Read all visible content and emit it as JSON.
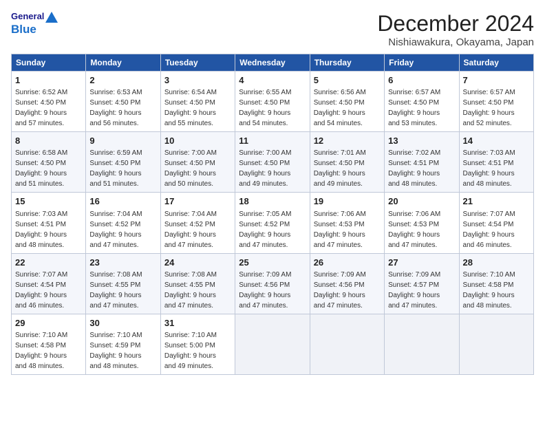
{
  "header": {
    "logo_line1": "General",
    "logo_line2": "Blue",
    "month": "December 2024",
    "location": "Nishiawakura, Okayama, Japan"
  },
  "columns": [
    "Sunday",
    "Monday",
    "Tuesday",
    "Wednesday",
    "Thursday",
    "Friday",
    "Saturday"
  ],
  "weeks": [
    [
      {
        "day": "1",
        "info": "Sunrise: 6:52 AM\nSunset: 4:50 PM\nDaylight: 9 hours\nand 57 minutes."
      },
      {
        "day": "2",
        "info": "Sunrise: 6:53 AM\nSunset: 4:50 PM\nDaylight: 9 hours\nand 56 minutes."
      },
      {
        "day": "3",
        "info": "Sunrise: 6:54 AM\nSunset: 4:50 PM\nDaylight: 9 hours\nand 55 minutes."
      },
      {
        "day": "4",
        "info": "Sunrise: 6:55 AM\nSunset: 4:50 PM\nDaylight: 9 hours\nand 54 minutes."
      },
      {
        "day": "5",
        "info": "Sunrise: 6:56 AM\nSunset: 4:50 PM\nDaylight: 9 hours\nand 54 minutes."
      },
      {
        "day": "6",
        "info": "Sunrise: 6:57 AM\nSunset: 4:50 PM\nDaylight: 9 hours\nand 53 minutes."
      },
      {
        "day": "7",
        "info": "Sunrise: 6:57 AM\nSunset: 4:50 PM\nDaylight: 9 hours\nand 52 minutes."
      }
    ],
    [
      {
        "day": "8",
        "info": "Sunrise: 6:58 AM\nSunset: 4:50 PM\nDaylight: 9 hours\nand 51 minutes."
      },
      {
        "day": "9",
        "info": "Sunrise: 6:59 AM\nSunset: 4:50 PM\nDaylight: 9 hours\nand 51 minutes."
      },
      {
        "day": "10",
        "info": "Sunrise: 7:00 AM\nSunset: 4:50 PM\nDaylight: 9 hours\nand 50 minutes."
      },
      {
        "day": "11",
        "info": "Sunrise: 7:00 AM\nSunset: 4:50 PM\nDaylight: 9 hours\nand 49 minutes."
      },
      {
        "day": "12",
        "info": "Sunrise: 7:01 AM\nSunset: 4:50 PM\nDaylight: 9 hours\nand 49 minutes."
      },
      {
        "day": "13",
        "info": "Sunrise: 7:02 AM\nSunset: 4:51 PM\nDaylight: 9 hours\nand 48 minutes."
      },
      {
        "day": "14",
        "info": "Sunrise: 7:03 AM\nSunset: 4:51 PM\nDaylight: 9 hours\nand 48 minutes."
      }
    ],
    [
      {
        "day": "15",
        "info": "Sunrise: 7:03 AM\nSunset: 4:51 PM\nDaylight: 9 hours\nand 48 minutes."
      },
      {
        "day": "16",
        "info": "Sunrise: 7:04 AM\nSunset: 4:52 PM\nDaylight: 9 hours\nand 47 minutes."
      },
      {
        "day": "17",
        "info": "Sunrise: 7:04 AM\nSunset: 4:52 PM\nDaylight: 9 hours\nand 47 minutes."
      },
      {
        "day": "18",
        "info": "Sunrise: 7:05 AM\nSunset: 4:52 PM\nDaylight: 9 hours\nand 47 minutes."
      },
      {
        "day": "19",
        "info": "Sunrise: 7:06 AM\nSunset: 4:53 PM\nDaylight: 9 hours\nand 47 minutes."
      },
      {
        "day": "20",
        "info": "Sunrise: 7:06 AM\nSunset: 4:53 PM\nDaylight: 9 hours\nand 47 minutes."
      },
      {
        "day": "21",
        "info": "Sunrise: 7:07 AM\nSunset: 4:54 PM\nDaylight: 9 hours\nand 46 minutes."
      }
    ],
    [
      {
        "day": "22",
        "info": "Sunrise: 7:07 AM\nSunset: 4:54 PM\nDaylight: 9 hours\nand 46 minutes."
      },
      {
        "day": "23",
        "info": "Sunrise: 7:08 AM\nSunset: 4:55 PM\nDaylight: 9 hours\nand 47 minutes."
      },
      {
        "day": "24",
        "info": "Sunrise: 7:08 AM\nSunset: 4:55 PM\nDaylight: 9 hours\nand 47 minutes."
      },
      {
        "day": "25",
        "info": "Sunrise: 7:09 AM\nSunset: 4:56 PM\nDaylight: 9 hours\nand 47 minutes."
      },
      {
        "day": "26",
        "info": "Sunrise: 7:09 AM\nSunset: 4:56 PM\nDaylight: 9 hours\nand 47 minutes."
      },
      {
        "day": "27",
        "info": "Sunrise: 7:09 AM\nSunset: 4:57 PM\nDaylight: 9 hours\nand 47 minutes."
      },
      {
        "day": "28",
        "info": "Sunrise: 7:10 AM\nSunset: 4:58 PM\nDaylight: 9 hours\nand 48 minutes."
      }
    ],
    [
      {
        "day": "29",
        "info": "Sunrise: 7:10 AM\nSunset: 4:58 PM\nDaylight: 9 hours\nand 48 minutes."
      },
      {
        "day": "30",
        "info": "Sunrise: 7:10 AM\nSunset: 4:59 PM\nDaylight: 9 hours\nand 48 minutes."
      },
      {
        "day": "31",
        "info": "Sunrise: 7:10 AM\nSunset: 5:00 PM\nDaylight: 9 hours\nand 49 minutes."
      },
      {
        "day": "",
        "info": ""
      },
      {
        "day": "",
        "info": ""
      },
      {
        "day": "",
        "info": ""
      },
      {
        "day": "",
        "info": ""
      }
    ]
  ]
}
